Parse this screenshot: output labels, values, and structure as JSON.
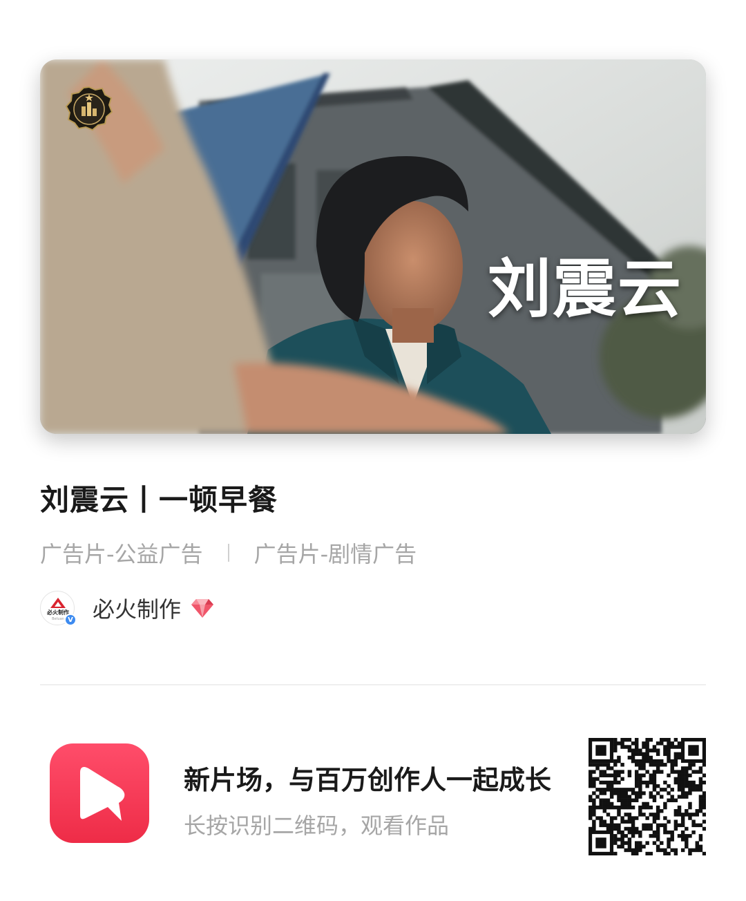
{
  "video": {
    "overlay_name": "刘震云",
    "badge": "award-badge-icon"
  },
  "title": "刘震云丨一顿早餐",
  "tags": [
    "广告片-公益广告",
    "广告片-剧情广告"
  ],
  "author": {
    "avatar_text": "必火制作",
    "avatar_subtext": "Betuan",
    "name": "必火制作",
    "badge_icon": "diamond-icon",
    "verified_mark": "V"
  },
  "promo": {
    "title": "新片场，与百万创作人一起成长",
    "subtitle": "长按识别二维码，观看作品",
    "logo_icon": "xinpianchang-logo-icon"
  },
  "colors": {
    "brand_red": "#ee2c47",
    "tag_gray": "#a6a6a6",
    "diamond": "#f0566a",
    "verified_blue": "#3d8bf0"
  }
}
